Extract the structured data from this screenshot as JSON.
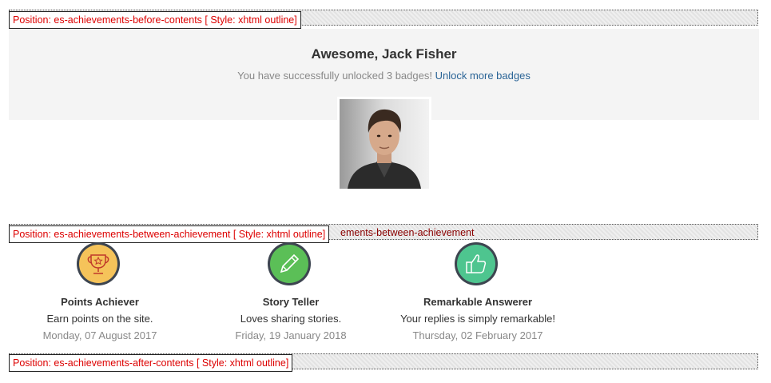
{
  "positions": {
    "before": "Position: es-achievements-before-contents [ Style: xhtml outline]",
    "between": "Position: es-achievements-between-achievement [ Style: xhtml outline]",
    "between_bar_text": "ements-between-achievement",
    "after": "Position: es-achievements-after-contents [ Style: xhtml outline]"
  },
  "hero": {
    "title": "Awesome, Jack Fisher",
    "subtitle": "You have successfully unlocked 3 badges!",
    "link": "Unlock more badges"
  },
  "badges": [
    {
      "name": "Points Achiever",
      "description": "Earn points on the site.",
      "date": "Monday, 07 August 2017",
      "icon": "trophy-icon",
      "color": "#f5c35a"
    },
    {
      "name": "Story Teller",
      "description": "Loves sharing stories.",
      "date": "Friday, 19 January 2018",
      "icon": "pencil-icon",
      "color": "#5bbf57"
    },
    {
      "name": "Remarkable Answerer",
      "description": "Your replies is simply remarkable!",
      "date": "Thursday, 02 February 2017",
      "icon": "thumbs-up-icon",
      "color": "#4ec58f"
    }
  ]
}
